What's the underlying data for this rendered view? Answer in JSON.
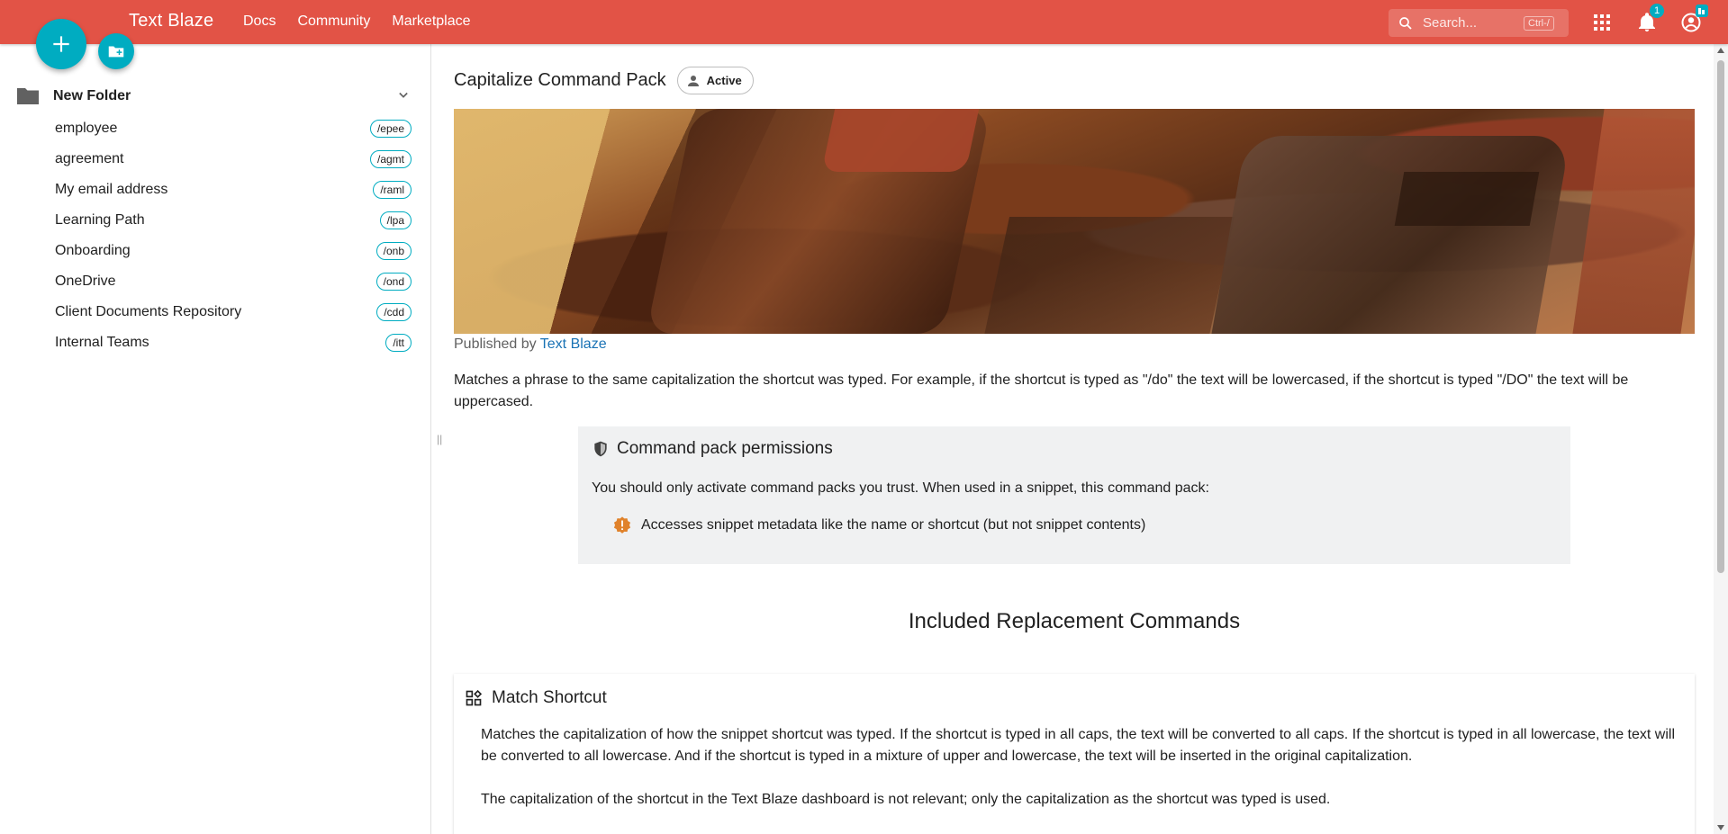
{
  "header": {
    "brand": "Text Blaze",
    "nav": [
      "Docs",
      "Community",
      "Marketplace"
    ],
    "search_placeholder": "Search...",
    "search_shortcut": "Ctrl-/",
    "notification_count": "1",
    "colors": {
      "header": "#e25346",
      "accent": "#00acc1"
    }
  },
  "sidebar": {
    "folder_label": "New Folder",
    "snippets": [
      {
        "name": "employee",
        "shortcut": "/epee"
      },
      {
        "name": "agreement",
        "shortcut": "/agmt"
      },
      {
        "name": "My email address",
        "shortcut": "/raml"
      },
      {
        "name": "Learning Path",
        "shortcut": "/lpa"
      },
      {
        "name": "Onboarding",
        "shortcut": "/onb"
      },
      {
        "name": "OneDrive",
        "shortcut": "/ond"
      },
      {
        "name": "Client Documents Repository",
        "shortcut": "/cdd"
      },
      {
        "name": "Internal Teams",
        "shortcut": "/itt"
      }
    ]
  },
  "main": {
    "title": "Capitalize Command Pack",
    "status_chip": "Active",
    "published_prefix": "Published by",
    "publisher": "Text Blaze",
    "description": "Matches a phrase to the same capitalization the shortcut was typed. For example, if the shortcut is typed as \"/do\" the text will be lowercased, if the shortcut is typed \"/DO\" the text will be uppercased.",
    "permissions": {
      "title": "Command pack permissions",
      "text": "You should only activate command packs you trust. When used in a snippet, this command pack:",
      "items": [
        "Accesses snippet metadata like the name or shortcut (but not snippet contents)"
      ]
    },
    "section_title": "Included Replacement Commands",
    "command": {
      "title": "Match Shortcut",
      "p1": "Matches the capitalization of how the snippet shortcut was typed. If the shortcut is typed in all caps, the text will be converted to all caps. If the shortcut is typed in all lowercase, the text will be converted to all lowercase. And if the shortcut is typed in a mixture of upper and lowercase, the text will be inserted in the original capitalization.",
      "p2": "The capitalization of the shortcut in the Text Blaze dashboard is not relevant; only the capitalization as the shortcut was typed is used."
    }
  }
}
